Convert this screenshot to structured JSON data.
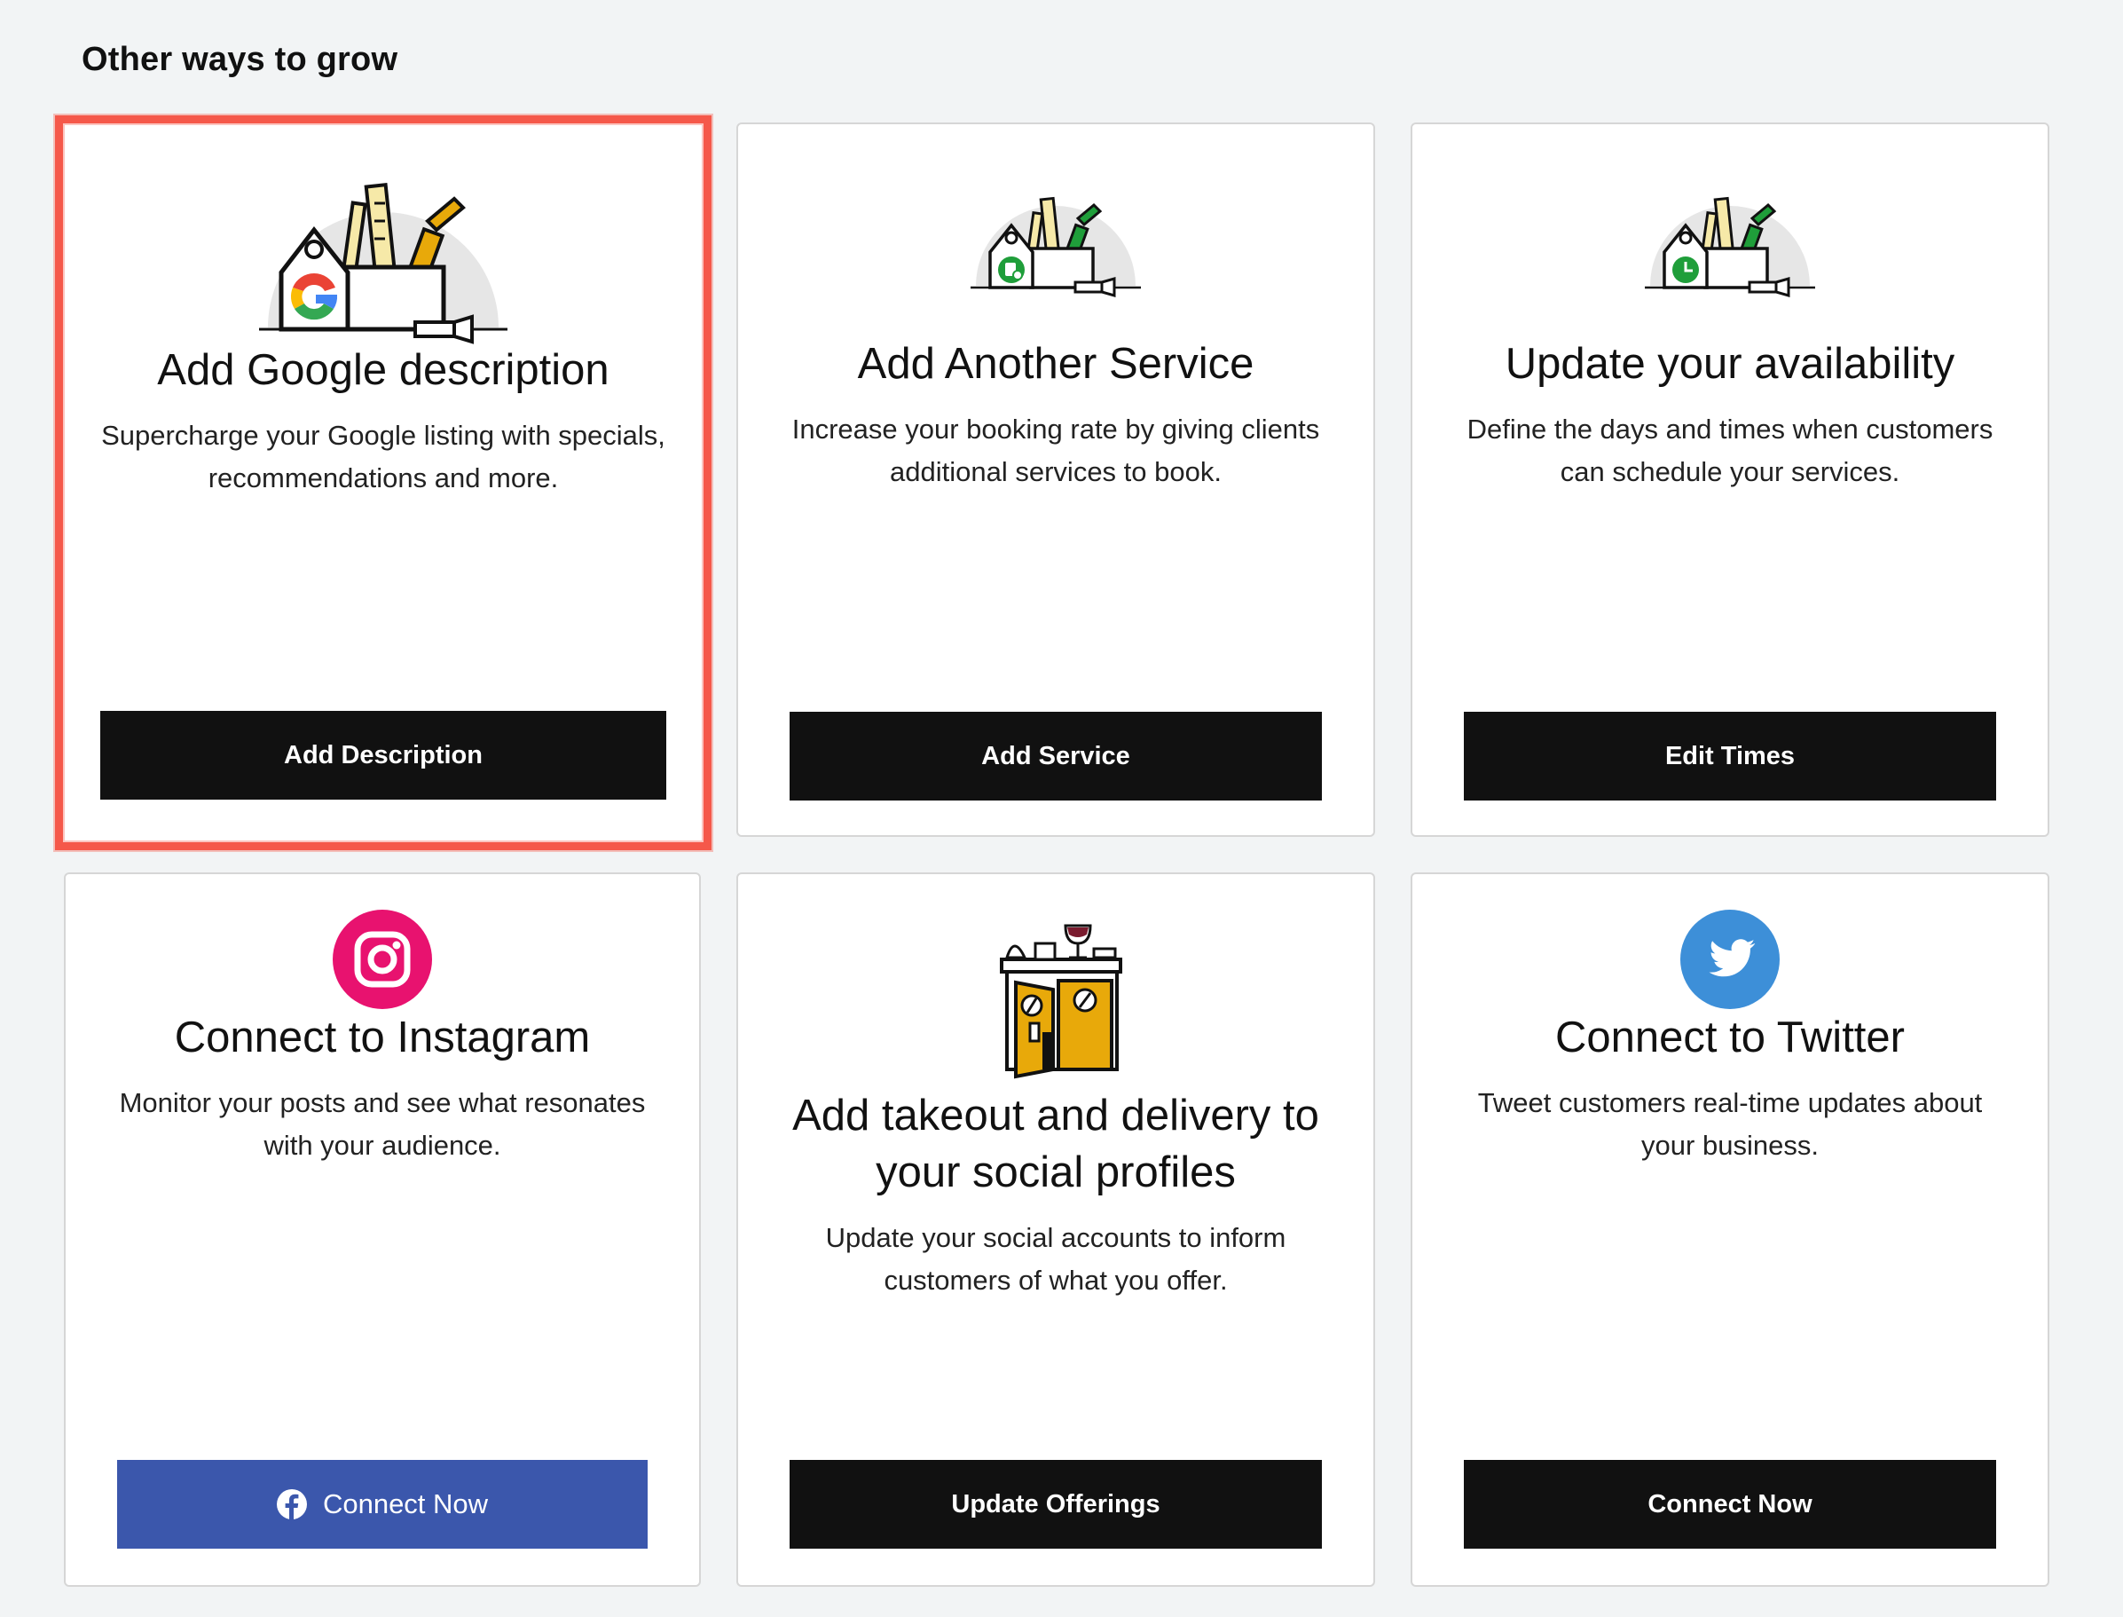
{
  "section": {
    "title": "Other ways to grow"
  },
  "cards": [
    {
      "title": "Add Google description",
      "description": "Supercharge your Google listing with specials, recommendations and more.",
      "button": "Add Description",
      "icon": "toolbox-google-icon",
      "highlighted": true
    },
    {
      "title": "Add Another Service",
      "description": "Increase your booking rate by giving clients additional services to book.",
      "button": "Add Service",
      "icon": "toolbox-service-icon"
    },
    {
      "title": "Update your availability",
      "description": "Define the days and times when customers can schedule your services.",
      "button": "Edit Times",
      "icon": "toolbox-clock-icon"
    },
    {
      "title": "Connect to Instagram",
      "description": "Monitor your posts and see what resonates with your audience.",
      "button": "Connect Now",
      "icon": "instagram-icon",
      "button_icon": "facebook-icon"
    },
    {
      "title": "Add takeout and delivery to your social profiles",
      "description": "Update your social accounts to inform customers of what you offer.",
      "button": "Update Offerings",
      "icon": "takeout-storefront-icon"
    },
    {
      "title": "Connect to Twitter",
      "description": "Tweet customers real-time updates about your business.",
      "button": "Connect Now",
      "icon": "twitter-icon"
    }
  ],
  "colors": {
    "highlight": "#f5584a",
    "button_dark": "#111111",
    "facebook_blue": "#3b57ac",
    "instagram_pink": "#e8126f",
    "twitter_blue": "#3d8fd8",
    "google_blue": "#4285f4",
    "google_red": "#ea4335",
    "google_yellow": "#fbbc05",
    "google_green": "#34a853",
    "tool_green": "#1f9e3a",
    "tool_yellow": "#e8a90a"
  }
}
